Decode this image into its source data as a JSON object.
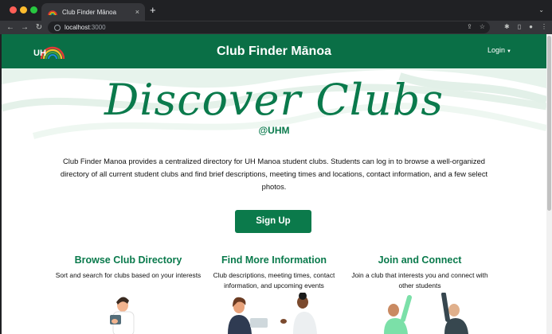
{
  "browser": {
    "tab_title": "Club Finder Mānoa",
    "close_glyph": "×",
    "new_tab_glyph": "+",
    "tab_menu_glyph": "⌄",
    "url_host": "localhost",
    "url_port": ":3000",
    "back_glyph": "←",
    "forward_glyph": "→",
    "reload_glyph": "↻",
    "share_glyph": "⇪",
    "star_glyph": "☆",
    "ext_glyph": "✱",
    "sidepanel_glyph": "▯",
    "profile_glyph": "●",
    "menu_glyph": "⋮",
    "traffic_colors": [
      "#ff5f57",
      "#febc2e",
      "#28c840"
    ]
  },
  "navbar": {
    "title": "Club Finder Mānoa",
    "login_label": "Login",
    "login_caret": "▼",
    "logo_text": "UH",
    "brand_color": "#0a6f46"
  },
  "hero": {
    "title": "Discover Clubs",
    "subtitle": "@UHM",
    "intro": "Club Finder Manoa provides a centralized directory for UH Manoa student clubs. Students can log in to browse a well-organized directory of all current student clubs and find brief descriptions, meeting times and locations, contact information, and a few select photos.",
    "accent_color": "#0a7a4c"
  },
  "signup_button": {
    "label": "Sign Up"
  },
  "features": [
    {
      "title": "Browse Club Directory",
      "desc": "Sort and search for clubs based on your interests"
    },
    {
      "title": "Find More Information",
      "desc": "Club descriptions, meeting times, contact information, and upcoming events"
    },
    {
      "title": "Join and Connect",
      "desc": "Join a club that interests you and connect with other students"
    }
  ]
}
